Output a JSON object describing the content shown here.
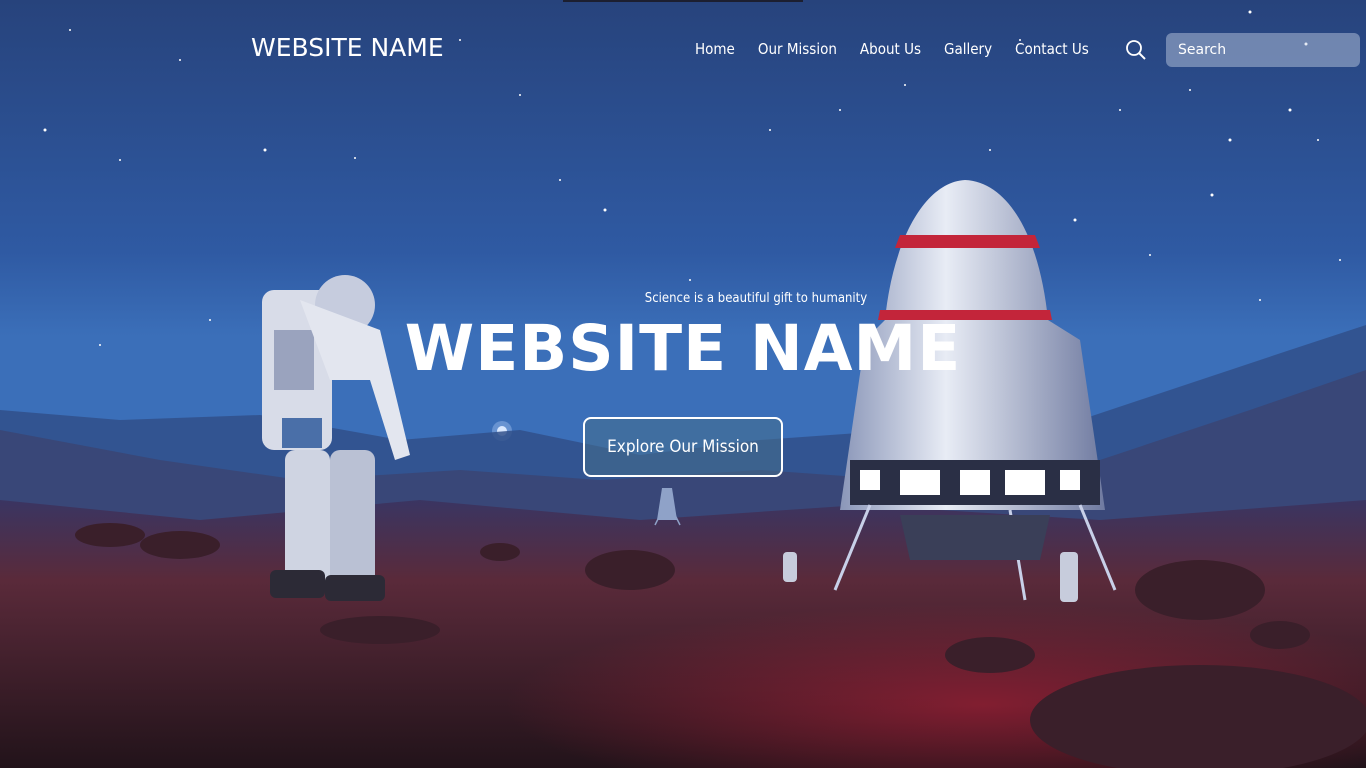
{
  "header": {
    "logo_text": "WEBSITE NAME",
    "nav": [
      {
        "label": "Home"
      },
      {
        "label": "Our Mission"
      },
      {
        "label": "About Us"
      },
      {
        "label": "Gallery"
      },
      {
        "label": "Contact Us"
      }
    ],
    "search": {
      "placeholder": "Search",
      "icon": "search-icon"
    }
  },
  "hero": {
    "tagline": "Science is a beautiful gift to humanity",
    "title": "WEBSITE NAME",
    "cta_label": "Explore Our Mission",
    "background_description_icon": "space-scene-background"
  },
  "colors": {
    "sky_top": "#2a4a85",
    "horizon": "#3a6bb8",
    "ground": "#4a2028",
    "text": "#ffffff"
  }
}
